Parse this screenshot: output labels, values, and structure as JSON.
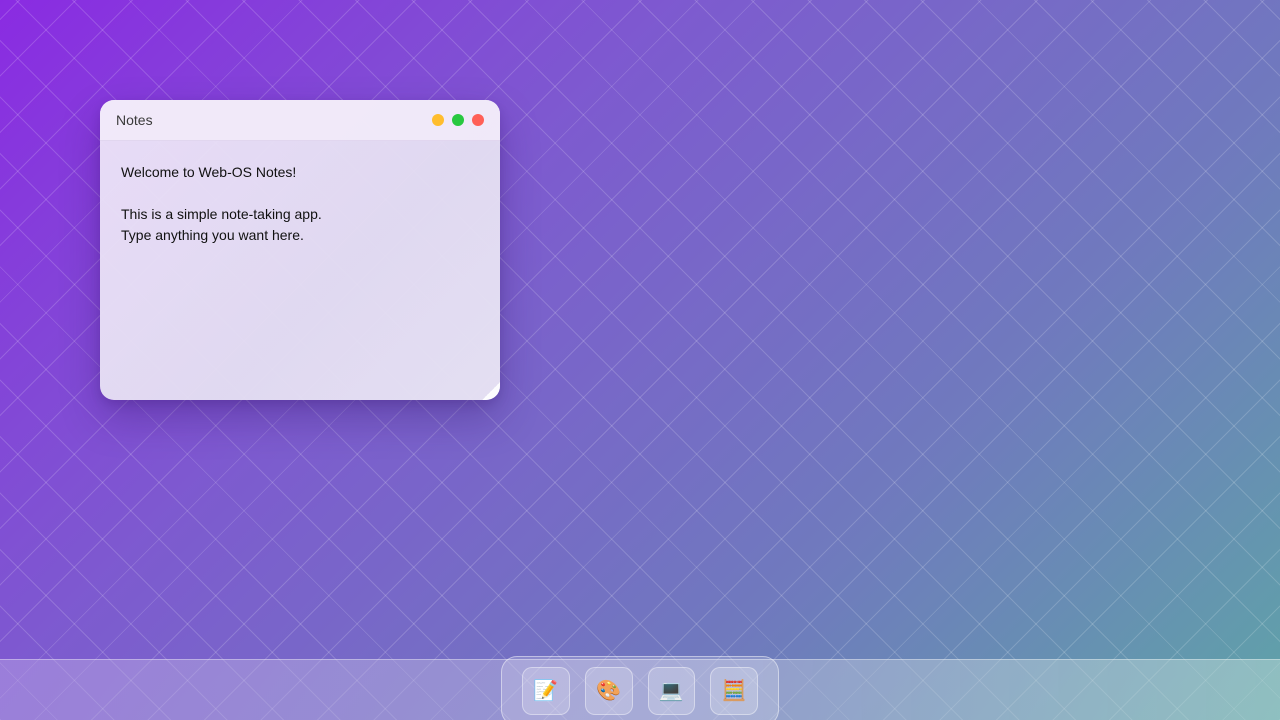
{
  "notes_window": {
    "title": "Notes",
    "content": "Welcome to Web-OS Notes!\n\nThis is a simple note-taking app.\nType anything you want here.",
    "controls": {
      "minimize_color": "#ffbd2e",
      "maximize_color": "#28c840",
      "close_color": "#ff5f57"
    }
  },
  "dock": {
    "items": [
      {
        "icon": "memo-icon",
        "glyph": "📝"
      },
      {
        "icon": "palette-icon",
        "glyph": "🎨"
      },
      {
        "icon": "laptop-icon",
        "glyph": "💻"
      },
      {
        "icon": "abacus-icon",
        "glyph": "🧮"
      }
    ]
  },
  "colors": {
    "background_start": "#8a2be2",
    "background_end": "#5fa3a8"
  }
}
